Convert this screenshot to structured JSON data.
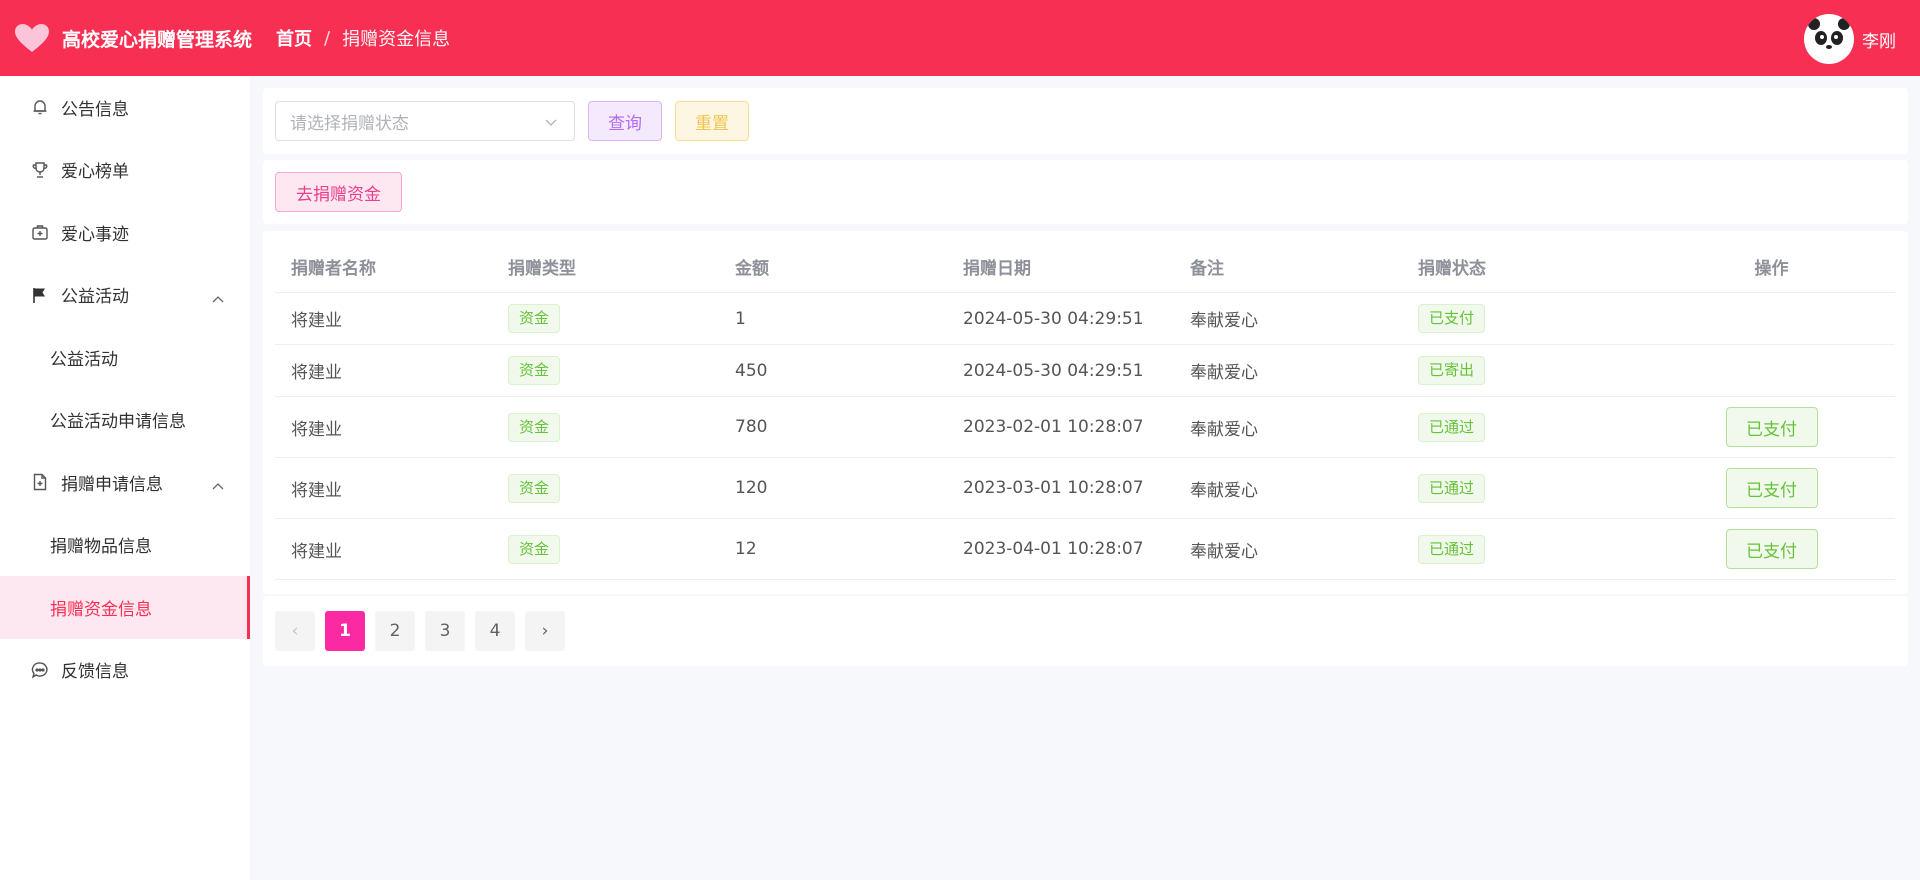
{
  "header": {
    "app_title": "高校爱心捐赠管理系统",
    "breadcrumb_home": "首页",
    "breadcrumb_sep": "/",
    "breadcrumb_current": "捐赠资金信息",
    "user_name": "李刚"
  },
  "sidebar": {
    "items": [
      {
        "label": "公告信息",
        "icon": "bell-icon"
      },
      {
        "label": "爱心榜单",
        "icon": "trophy-icon"
      },
      {
        "label": "爱心事迹",
        "icon": "medical-box-icon"
      },
      {
        "label": "公益活动",
        "icon": "flag-icon"
      },
      {
        "label": "公益活动"
      },
      {
        "label": "公益活动申请信息"
      },
      {
        "label": "捐赠申请信息",
        "icon": "document-add-icon"
      },
      {
        "label": "捐赠物品信息"
      },
      {
        "label": "捐赠资金信息"
      },
      {
        "label": "反馈信息",
        "icon": "chat-icon"
      }
    ]
  },
  "search": {
    "status_placeholder": "请选择捐赠状态",
    "query_label": "查询",
    "reset_label": "重置"
  },
  "actions": {
    "donate_label": "去捐赠资金"
  },
  "table": {
    "headers": [
      "捐赠者名称",
      "捐赠类型",
      "金额",
      "捐赠日期",
      "备注",
      "捐赠状态",
      "操作"
    ],
    "rows": [
      {
        "name": "将建业",
        "type": "资金",
        "amount": "1",
        "date": "2024-05-30 04:29:51",
        "note": "奉献爱心",
        "status": "已支付",
        "action": ""
      },
      {
        "name": "将建业",
        "type": "资金",
        "amount": "450",
        "date": "2024-05-30 04:29:51",
        "note": "奉献爱心",
        "status": "已寄出",
        "action": ""
      },
      {
        "name": "将建业",
        "type": "资金",
        "amount": "780",
        "date": "2023-02-01 10:28:07",
        "note": "奉献爱心",
        "status": "已通过",
        "action": "已支付"
      },
      {
        "name": "将建业",
        "type": "资金",
        "amount": "120",
        "date": "2023-03-01 10:28:07",
        "note": "奉献爱心",
        "status": "已通过",
        "action": "已支付"
      },
      {
        "name": "将建业",
        "type": "资金",
        "amount": "12",
        "date": "2023-04-01 10:28:07",
        "note": "奉献爱心",
        "status": "已通过",
        "action": "已支付"
      }
    ]
  },
  "pagination": {
    "prev": "‹",
    "pages": [
      "1",
      "2",
      "3",
      "4"
    ],
    "current": "1",
    "next": "›"
  },
  "colors": {
    "brand": "#f72f52",
    "active_page": "#fb2aa3",
    "success": "#67c23a"
  }
}
